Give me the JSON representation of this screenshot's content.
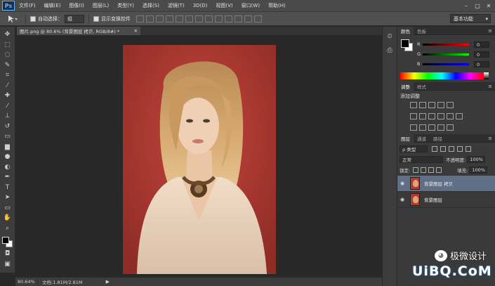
{
  "app": {
    "logo": "Ps"
  },
  "menu": [
    "文件(F)",
    "编辑(E)",
    "图像(I)",
    "图层(L)",
    "类型(Y)",
    "选择(S)",
    "滤镜(T)",
    "3D(D)",
    "视图(V)",
    "窗口(W)",
    "帮助(H)"
  ],
  "window_controls": {
    "minimize": "–",
    "restore": "▢",
    "close": "✕"
  },
  "options": {
    "auto_select_label": "自动选择：",
    "auto_select_value": "组",
    "show_transform_label": "显示变换控件",
    "workspace": "基本功能"
  },
  "document": {
    "tab_title": "图片.png @ 80.6% (背景图层 拷贝, RGB/8#) *",
    "zoom": "80.64%",
    "doc_size": "文档:1.81M/2.81M"
  },
  "color_panel": {
    "tabs": [
      "颜色",
      "色板"
    ],
    "labels": [
      "R",
      "G",
      "B"
    ],
    "values": [
      "0",
      "0",
      "0"
    ]
  },
  "adjustments_panel": {
    "tabs": [
      "调整",
      "样式"
    ],
    "title": "添加调整"
  },
  "layers_panel": {
    "tabs": [
      "图层",
      "通道",
      "路径"
    ],
    "filter_kind": "ρ 类型",
    "blend_mode": "正常",
    "opacity_label": "不透明度:",
    "opacity_value": "100%",
    "lock_label": "锁定:",
    "fill_label": "填充:",
    "fill_value": "100%",
    "layers": [
      {
        "name": "背景图层 拷贝",
        "selected": true
      },
      {
        "name": "背景图层",
        "selected": false
      }
    ]
  },
  "watermark": {
    "cn": "极微设计",
    "big": "UiBQ.CoM"
  },
  "colors": {
    "canvas_bg": "#282828",
    "photo_bg": "#b33a32",
    "selected_layer": "#5f6f86"
  }
}
